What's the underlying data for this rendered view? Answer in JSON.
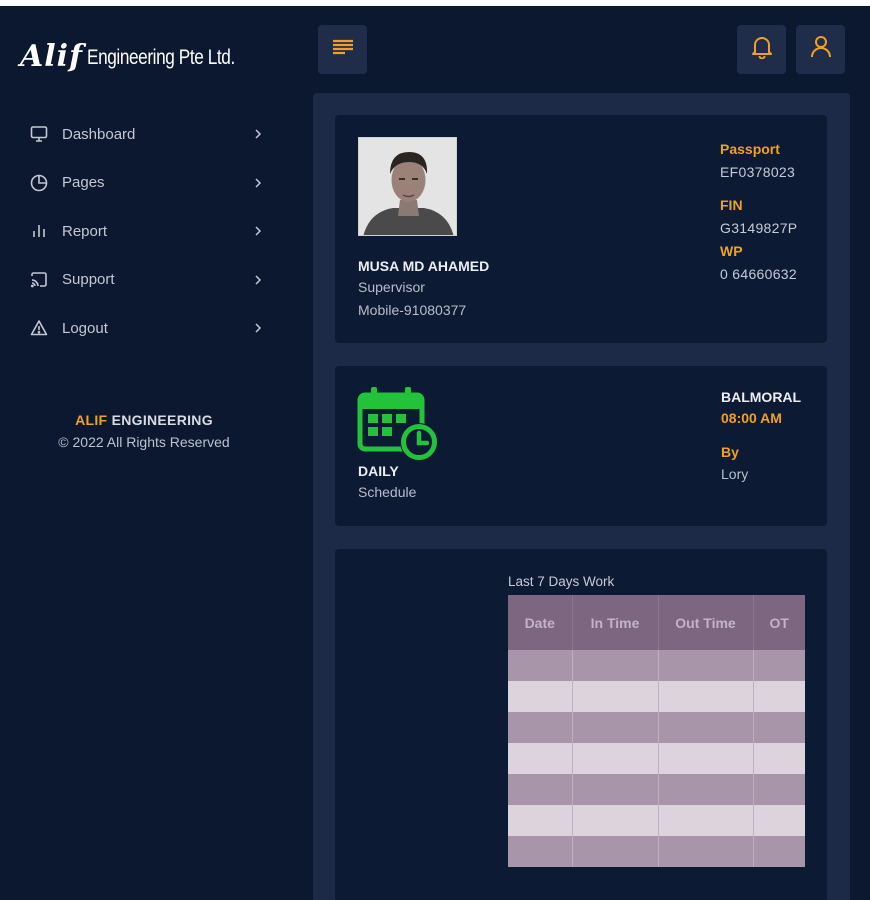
{
  "brand": {
    "logo": "Alif",
    "name": "Engineering Pte Ltd."
  },
  "nav": {
    "items": [
      {
        "label": "Dashboard",
        "icon": "monitor-icon"
      },
      {
        "label": "Pages",
        "icon": "pie-chart-icon"
      },
      {
        "label": "Report",
        "icon": "bar-chart-icon"
      },
      {
        "label": "Support",
        "icon": "cast-icon"
      },
      {
        "label": "Logout",
        "icon": "warning-icon"
      }
    ]
  },
  "footer": {
    "accent": "ALIF",
    "rest": " ENGINEERING",
    "copyright": "© 2022 All Rights Reserved"
  },
  "header": {
    "menu_icon": "menu-icon",
    "notification_icon": "bell-icon",
    "user_icon": "user-icon"
  },
  "profile": {
    "name": "MUSA MD AHAMED",
    "role": "Supervisor",
    "mobile": "Mobile-91080377",
    "passport_label": "Passport",
    "passport": "EF0378023",
    "fin_label": "FIN",
    "fin": "G3149827P",
    "wp_label": "WP",
    "wp": "0 64660632"
  },
  "schedule": {
    "icon": "calendar-clock-icon",
    "type": "DAILY",
    "label": "Schedule",
    "location": "BALMORAL",
    "time": "08:00 AM",
    "by_label": "By",
    "by": "Lory"
  },
  "work": {
    "title": "Last 7 Days Work",
    "columns": [
      "Date",
      "In Time",
      "Out Time",
      "OT"
    ],
    "rows": [
      [
        "",
        "",
        "",
        ""
      ],
      [
        "",
        "",
        "",
        ""
      ],
      [
        "",
        "",
        "",
        ""
      ],
      [
        "",
        "",
        "",
        ""
      ],
      [
        "",
        "",
        "",
        ""
      ],
      [
        "",
        "",
        "",
        ""
      ],
      [
        "",
        "",
        "",
        ""
      ]
    ]
  },
  "colors": {
    "background": "#0c1830",
    "panel": "#1c2a47",
    "card": "#0d1a33",
    "accent": "#f0a023",
    "schedule_icon": "#22c33a"
  }
}
